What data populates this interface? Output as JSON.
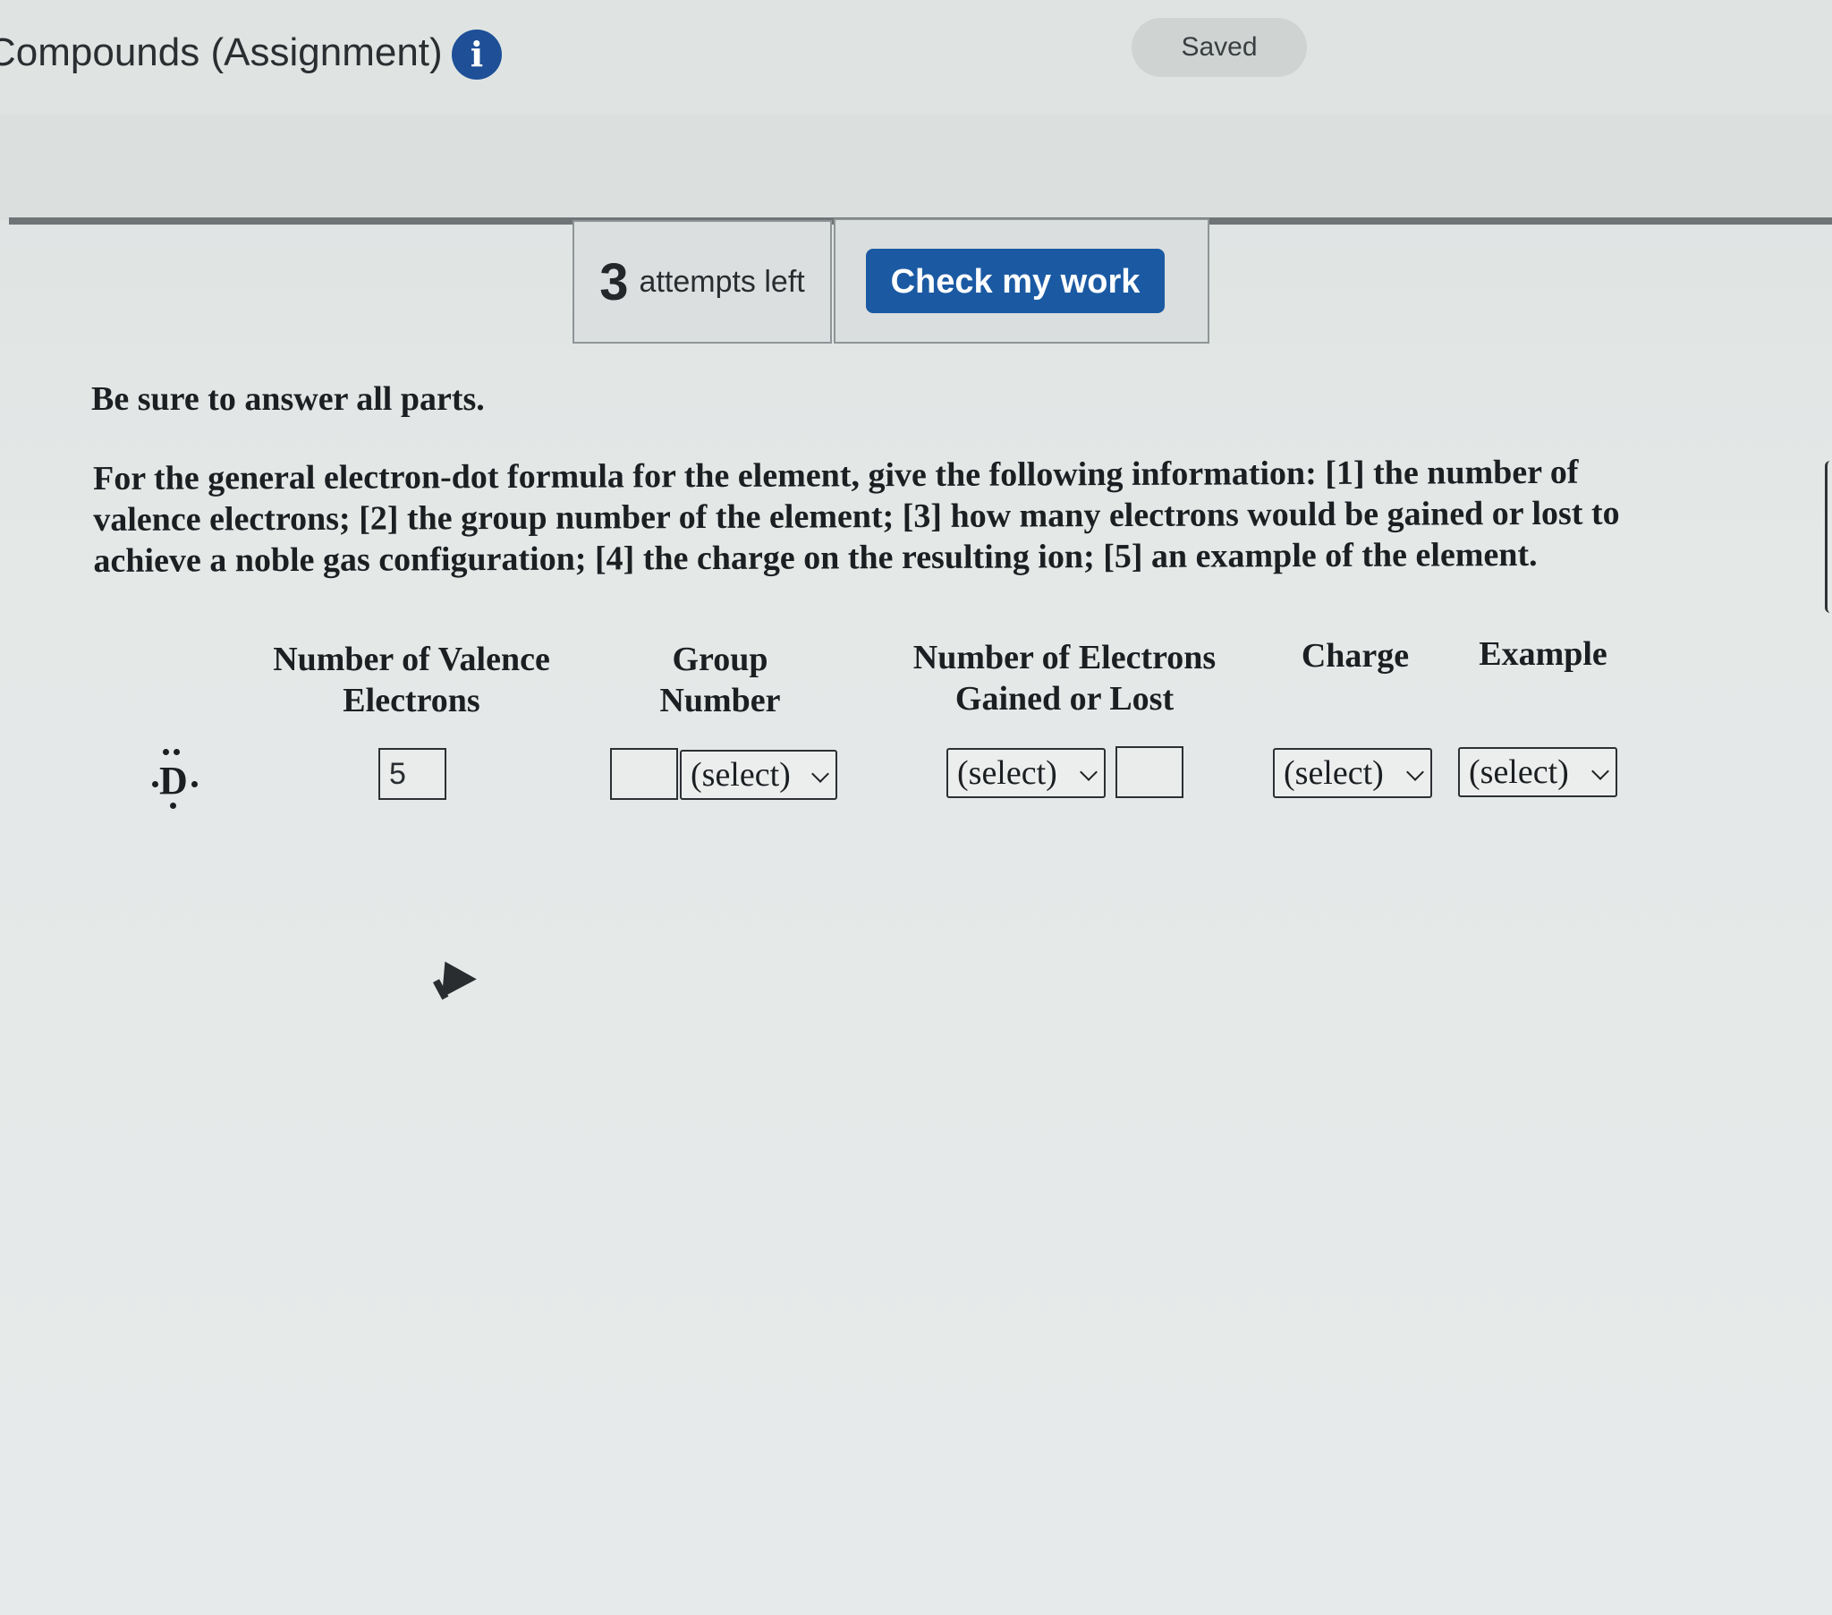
{
  "header": {
    "title": "Compounds (Assignment)",
    "info_icon": "info-icon",
    "saved_label": "Saved"
  },
  "toolbar": {
    "attempts_count": "3",
    "attempts_label": "attempts left",
    "check_button_label": "Check my work"
  },
  "instructions": "Be sure to answer all parts.",
  "question": "For the general electron-dot formula for the element, give the following information: [1] the number of valence electrons; [2] the group number of the element; [3] how many electrons would be gained or lost to achieve a noble gas configuration; [4] the charge on the resulting ion; [5] an example of the element.",
  "table": {
    "headers": {
      "valence": "Number of Valence Electrons",
      "group": "Group Number",
      "gained_lost": "Number of Electrons Gained or Lost",
      "charge": "Charge",
      "example": "Example"
    },
    "element_symbol": "D",
    "valence_value": "5",
    "group_number_value": "",
    "group_select": "(select)",
    "gained_lost_select": "(select)",
    "gained_lost_value": "",
    "charge_select": "(select)",
    "example_select": "(select)"
  },
  "colors": {
    "accent": "#1b5aa3",
    "info_icon": "#1e4f97",
    "background": "#e3e7e6"
  }
}
